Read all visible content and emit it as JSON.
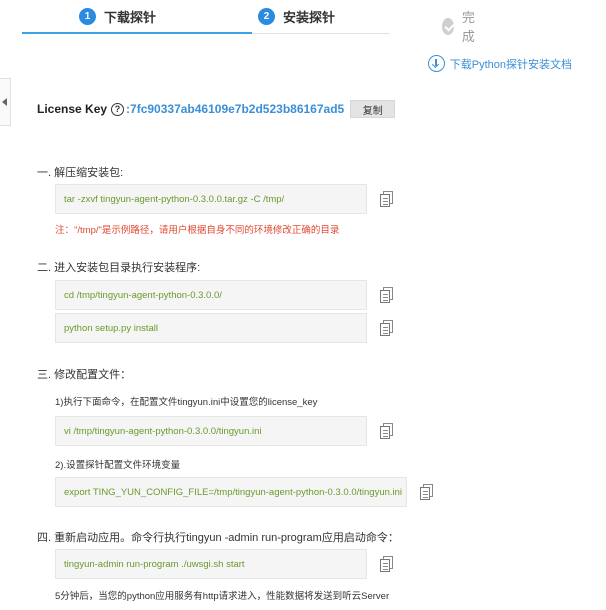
{
  "steps": [
    {
      "num": "1",
      "label": "下载探针"
    },
    {
      "num": "2",
      "label": "安装探针"
    },
    {
      "label": "完成"
    }
  ],
  "doc_link": "下载Python探针安装文档",
  "license": {
    "label": "License Key",
    "key": ":7fc90337ab46109e7b2d523b86167ad5",
    "copy_label": "复制"
  },
  "sections": {
    "s1": {
      "title": "一. 解压缩安装包:",
      "cmd": "tar -zxvf tingyun-agent-python-0.3.0.0.tar.gz -C /tmp/",
      "note": "注：\"/tmp/\"是示例路径，请用户根据自身不同的环境修改正确的目录"
    },
    "s2": {
      "title": "二. 进入安装包目录执行安装程序:",
      "cmd1": "cd /tmp/tingyun-agent-python-0.3.0.0/",
      "cmd2": "python setup.py install"
    },
    "s3": {
      "title": "三. 修改配置文件：",
      "sub1": "1)执行下面命令，在配置文件tingyun.ini中设置您的license_key",
      "cmd1": "vi /tmp/tingyun-agent-python-0.3.0.0/tingyun.ini",
      "sub2": "2).设置探针配置文件环境变量",
      "cmd2": "export TING_YUN_CONFIG_FILE=/tmp/tingyun-agent-python-0.3.0.0/tingyun.ini"
    },
    "s4": {
      "title": "四. 重新启动应用。命令行执行tingyun -admin run-program应用启动命令：",
      "cmd": "tingyun-admin run-program ./uwsgi.sh start",
      "footer": "5分钟后，当您的python应用服务有http请求进入，性能数据将发送到听云Server"
    }
  },
  "colors": {
    "accent": "#2b8be0",
    "link": "#3a8fd6",
    "command_text": "#6a9a2e",
    "warning": "#e0472f"
  }
}
